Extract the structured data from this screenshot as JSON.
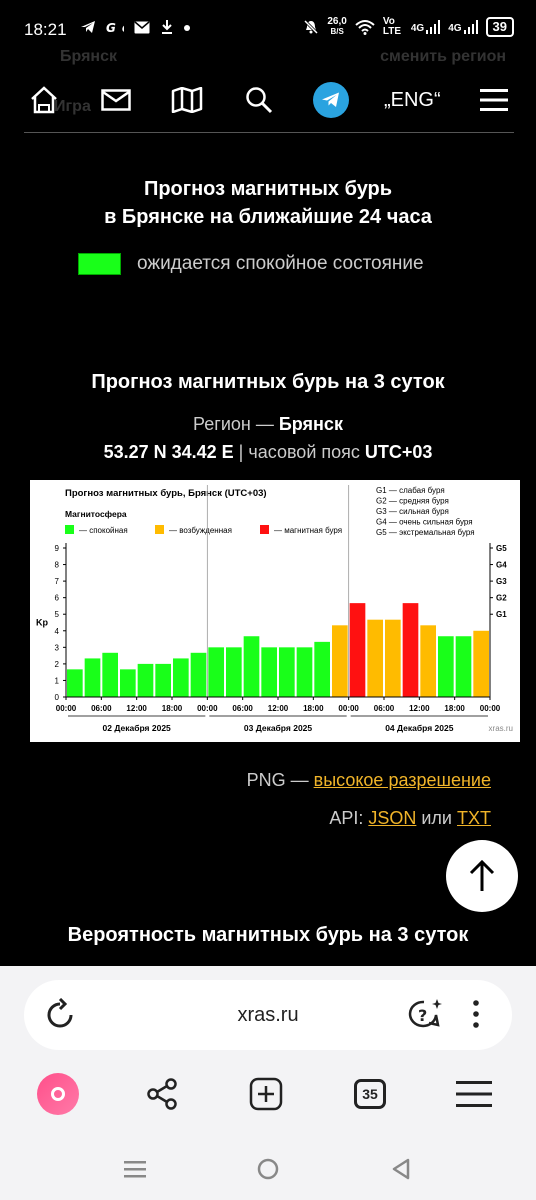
{
  "status_bar": {
    "time": "18:21",
    "left_icons": [
      "telegram-icon",
      "app-icon",
      "mail-icon",
      "download-icon",
      "dot-icon"
    ],
    "net_speed_value": "26,0",
    "net_speed_unit": "B/S",
    "volte": "Vo LTE",
    "network_1": "4G",
    "network_2": "4G",
    "battery": "39"
  },
  "behind_header": {
    "city": "Брянск",
    "change_region": "сменить регион",
    "back": "Игра"
  },
  "nav": {
    "icons": [
      "home-icon",
      "mail-icon",
      "map-icon",
      "search-icon",
      "telegram-icon",
      "menu-icon"
    ],
    "lang": "„ENG“"
  },
  "forecast24": {
    "title_line1": "Прогноз магнитных бурь",
    "title_line2": "в Брянске на ближайшие 24 часа",
    "legend_text": "ожидается спокойное состояние",
    "legend_color": "#19ff19"
  },
  "forecast3": {
    "title": "Прогноз магнитных бурь на 3 суток",
    "region_label": "Регион — ",
    "region_value": "Брянск",
    "coords": "53.27 N 34.42 E",
    "tz_sep": " | часовой пояс ",
    "tz_value": "UTC+03"
  },
  "chart_data": {
    "type": "bar",
    "title": "Прогноз магнитных бурь, Брянск (UTC+03)",
    "subtitle": "Магнитосфера",
    "legend": [
      {
        "label": "— спокойная",
        "color": "#19ff19"
      },
      {
        "label": "— возбужденная",
        "color": "#ffbb00"
      },
      {
        "label": "— магнитная буря",
        "color": "#ff1111"
      }
    ],
    "g_legend": [
      "G1 — слабая буря",
      "G2 — средняя буря",
      "G3 — сильная буря",
      "G4 — очень сильная буря",
      "G5 — экстремальная буря"
    ],
    "ylabel": "Kp",
    "ylim": [
      0,
      9
    ],
    "y_ticks": [
      "0",
      "1",
      "2",
      "3",
      "4",
      "5",
      "6",
      "7",
      "8",
      "9"
    ],
    "g_ticks": [
      {
        "label": "G1",
        "kp": 5
      },
      {
        "label": "G2",
        "kp": 6
      },
      {
        "label": "G3",
        "kp": 7
      },
      {
        "label": "G4",
        "kp": 8
      },
      {
        "label": "G5",
        "kp": 9
      }
    ],
    "x_tick_labels": [
      "00:00",
      "06:00",
      "12:00",
      "18:00",
      "00:00",
      "06:00",
      "12:00",
      "18:00",
      "00:00",
      "06:00",
      "12:00",
      "18:00",
      "00:00"
    ],
    "days": [
      "02 Декабря 2025",
      "03 Декабря 2025",
      "04 Декабря 2025"
    ],
    "values": [
      1.67,
      2.33,
      2.67,
      1.67,
      2.0,
      2.0,
      2.33,
      2.67,
      3.0,
      3.0,
      3.67,
      3.0,
      3.0,
      3.0,
      3.33,
      4.33,
      5.67,
      4.67,
      4.67,
      5.67,
      4.33,
      3.67,
      3.67,
      4.0
    ],
    "colors": {
      "quiet": "#19ff19",
      "active": "#ffbb00",
      "storm": "#ff1111"
    },
    "watermark": "xras.ru"
  },
  "links": {
    "png_label": "PNG — ",
    "png_link": "высокое разрешение",
    "api_label": "API: ",
    "json": "JSON",
    "or": " или ",
    "txt": "TXT"
  },
  "probability": {
    "title": "Вероятность магнитных бурь на 3 суток"
  },
  "browser": {
    "url": "xras.ru",
    "tabs_count": "35"
  }
}
